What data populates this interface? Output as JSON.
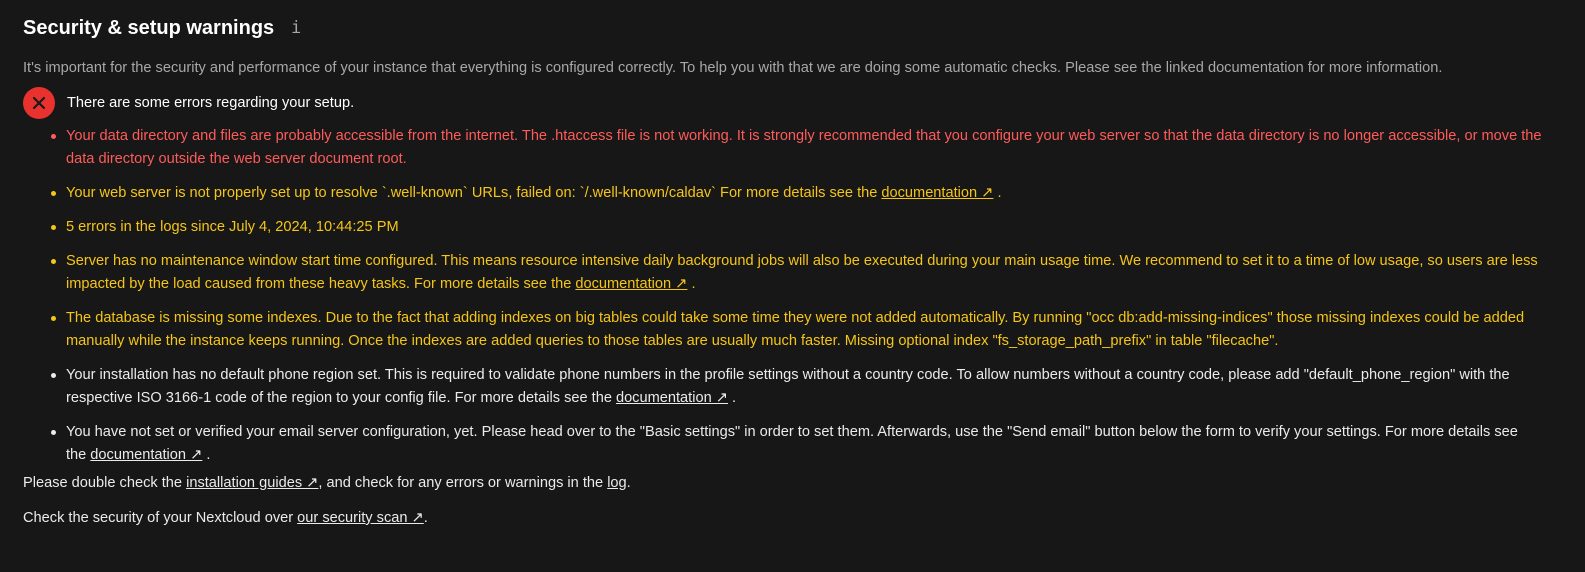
{
  "section": {
    "title": "Security & setup warnings",
    "info_icon": "info-icon",
    "intro": "It's important for the security and performance of your instance that everything is configured correctly. To help you with that we are doing some automatic checks. Please see the linked documentation for more information."
  },
  "status": {
    "icon": "close-icon",
    "text": "There are some errors regarding your setup.",
    "color": "#e9322d"
  },
  "colors": {
    "error": "#ff5b5b",
    "warning": "#f5c518",
    "info": "#ebebeb"
  },
  "warnings": [
    {
      "severity": "error",
      "text": "Your data directory and files are probably accessible from the internet. The .htaccess file is not working. It is strongly recommended that you configure your web server so that the data directory is no longer accessible, or move the data directory outside the web server document root.",
      "link": ""
    },
    {
      "severity": "warning",
      "text": "Your web server is not properly set up to resolve `.well-known` URLs, failed on: `/.well-known/caldav` For more details see the",
      "link": "documentation ↗"
    },
    {
      "severity": "warning",
      "text": "5 errors in the logs since July 4, 2024, 10:44:25 PM",
      "link": ""
    },
    {
      "severity": "warning",
      "text": "Server has no maintenance window start time configured. This means resource intensive daily background jobs will also be executed during your main usage time. We recommend to set it to a time of low usage, so users are less impacted by the load caused from these heavy tasks. For more details see the",
      "link": "documentation ↗"
    },
    {
      "severity": "warning",
      "text": "The database is missing some indexes. Due to the fact that adding indexes on big tables could take some time they were not added automatically. By running \"occ db:add-missing-indices\" those missing indexes could be added manually while the instance keeps running. Once the indexes are added queries to those tables are usually much faster. Missing optional index \"fs_storage_path_prefix\" in table \"filecache\".",
      "link": ""
    },
    {
      "severity": "info",
      "text": "Your installation has no default phone region set. This is required to validate phone numbers in the profile settings without a country code. To allow numbers without a country code, please add \"default_phone_region\" with the respective ISO 3166-1 code of the region to your config file. For more details see the",
      "link": "documentation ↗"
    },
    {
      "severity": "info",
      "text": "You have not set or verified your email server configuration, yet. Please head over to the \"Basic settings\" in order to set them. Afterwards, use the \"Send email\" button below the form to verify your settings. For more details see the",
      "link": "documentation ↗"
    }
  ],
  "footer": {
    "line1_prefix": "Please double check the",
    "line1_link": "installation guides ↗",
    "line1_middle": ", and check for any errors or warnings in the",
    "line1_log_link": "log",
    "line1_suffix": ".",
    "line2_prefix": "Check the security of your Nextcloud over",
    "line2_link": "our security scan ↗",
    "line2_suffix": "."
  }
}
